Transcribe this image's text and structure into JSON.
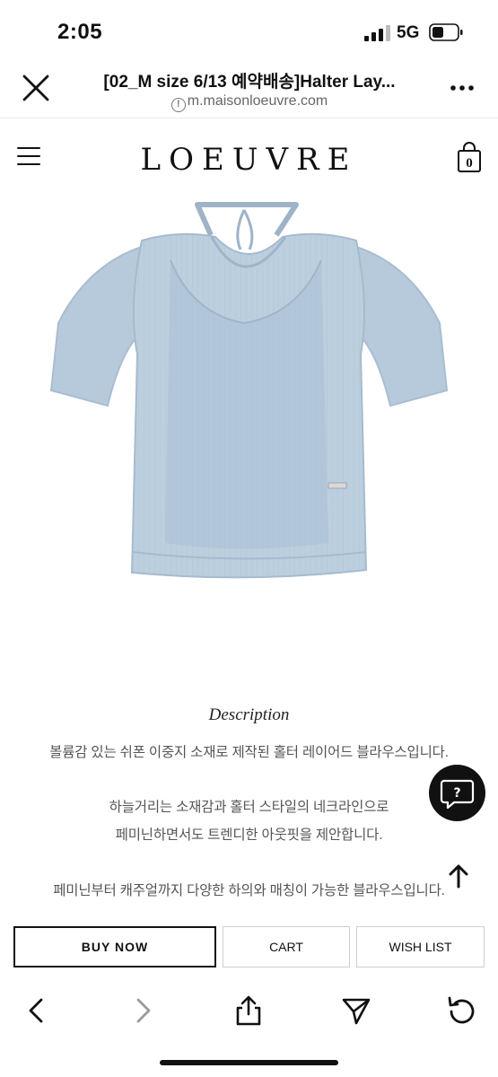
{
  "status_bar": {
    "time": "2:05",
    "network": "5G"
  },
  "browser": {
    "title": "[02_M size 6/13 예약배송]Halter Lay...",
    "url": "m.maisonloeuvre.com",
    "info_glyph": "!",
    "icons": {
      "close": "close-icon",
      "more": "more-icon",
      "info": "info-icon"
    }
  },
  "site": {
    "logo": "LOEUVRE",
    "cart_count": "0",
    "icons": {
      "menu": "hamburger-icon",
      "cart": "shopping-bag-icon"
    }
  },
  "product": {
    "image": "light-blue-sheer-halter-layered-blouse",
    "color": "#b4c8da"
  },
  "description": {
    "heading": "Description",
    "lines": [
      "볼륨감 있는 쉬폰 이중지 소재로 제작된 홀터 레이어드 블라우스입니다.",
      "하늘거리는 소재감과 홀터 스타일의 네크라인으로",
      "페미닌하면서도 트렌디한 아웃핏을 제안합니다.",
      "페미닌부터 캐주얼까지 다양한 하의와 매칭이 가능한 블라우스입니다."
    ]
  },
  "floating": {
    "chat_glyph": "?",
    "icons": {
      "chat": "chat-bubble-icon",
      "top": "arrow-up-icon"
    }
  },
  "actions": {
    "buy_now": "BUY NOW",
    "cart": "CART",
    "wish_list": "WISH LIST"
  },
  "toolbar": {
    "icons": [
      "back-icon",
      "forward-icon",
      "share-icon",
      "send-icon",
      "reload-icon"
    ]
  }
}
